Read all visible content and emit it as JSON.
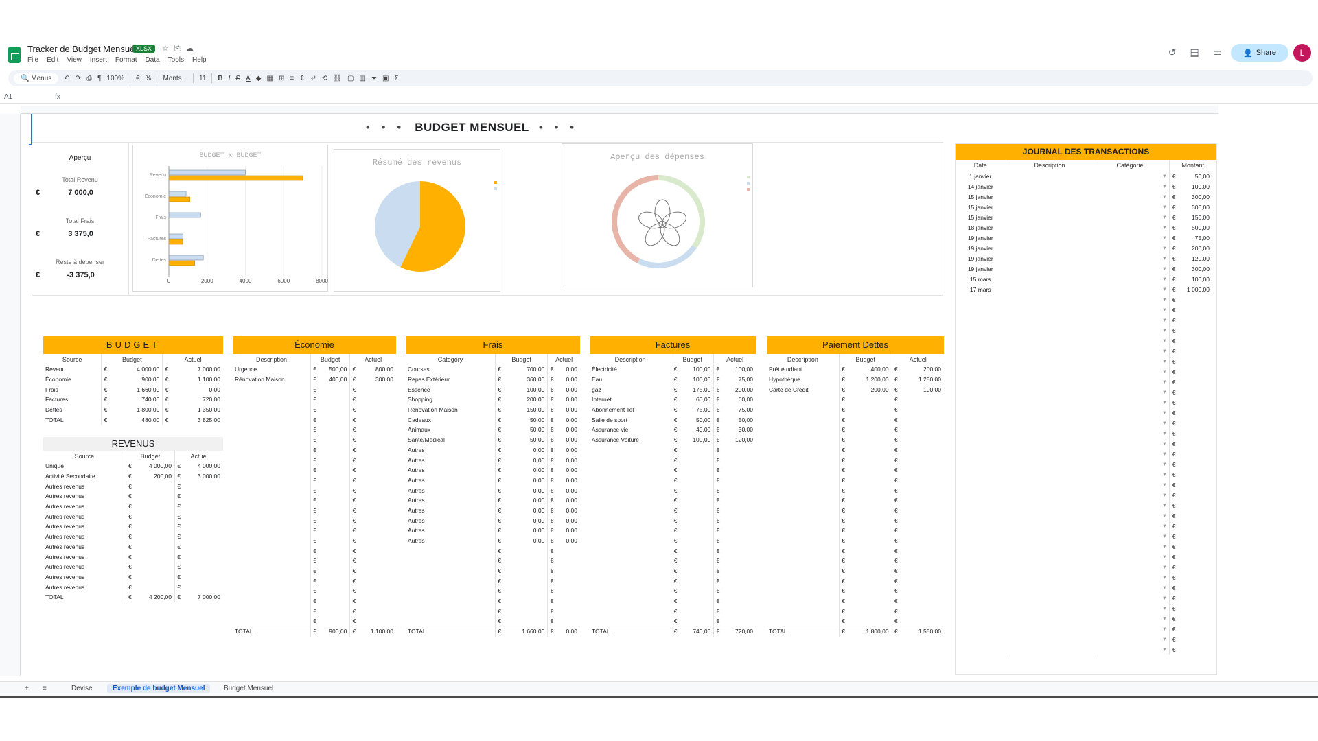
{
  "app": {
    "title": "Tracker de Budget Mensuel",
    "badge": "XLSX",
    "menu": [
      "File",
      "Edit",
      "View",
      "Insert",
      "Format",
      "Data",
      "Tools",
      "Help"
    ],
    "share_label": "Share",
    "avatar_letter": "L",
    "colors": {
      "accent": "#ffb000",
      "blue": "#c9dcf0",
      "sheets_green": "#0f9d58"
    }
  },
  "toolbar": {
    "menus_label": "Menus",
    "zoom": "100%",
    "font": "Monts...",
    "font_size": "11"
  },
  "formula": {
    "cell_ref": "A1",
    "fx": "fx"
  },
  "sheet": {
    "title": "BUDGET MENSUEL",
    "dots": "• • •"
  },
  "overview": {
    "heading": "Aperçu",
    "kpis": [
      {
        "label": "Total Revenu",
        "currency": "€",
        "value": "7 000,0"
      },
      {
        "label": "Total Frais",
        "currency": "€",
        "value": "3 375,0"
      },
      {
        "label": "Reste à dépenser",
        "currency": "€",
        "value": "-3 375,0"
      }
    ]
  },
  "chart_data": [
    {
      "type": "bar",
      "title": "BUDGET x BUDGET",
      "categories": [
        "Revenu",
        "Économie",
        "Frais",
        "Factures",
        "Dettes"
      ],
      "series": [
        {
          "values": [
            4000,
            900,
            1660,
            740,
            1800
          ]
        },
        {
          "values": [
            7000,
            1100,
            0,
            720,
            1350
          ]
        }
      ],
      "xlim": [
        0,
        8000
      ],
      "xticks": [
        0,
        2000,
        4000,
        6000,
        8000
      ],
      "colors": [
        "#c9dcf0",
        "#ffb000"
      ]
    },
    {
      "type": "pie",
      "title": "Résumé des revenus",
      "slices": [
        {
          "label": "Unique",
          "value": 4000,
          "color": "#ffb000"
        },
        {
          "label": "Activité Secondaire",
          "value": 3000,
          "color": "#c9dcf0"
        }
      ]
    },
    {
      "type": "pie",
      "title": "Aperçu des dépenses",
      "slices": [
        {
          "value": 1100,
          "color": "#d8e9cc"
        },
        {
          "value": 720,
          "color": "#c9dcf0"
        },
        {
          "value": 1350,
          "color": "#e8b4a8"
        }
      ]
    }
  ],
  "panels": {
    "budget": {
      "title": "BUDGET",
      "headers": [
        "Source",
        "Budget",
        "Actuel"
      ],
      "rows": [
        [
          "Revenu",
          "€",
          "4 000,00",
          "€",
          "7 000,00"
        ],
        [
          "Économie",
          "€",
          "900,00",
          "€",
          "1 100,00"
        ],
        [
          "Frais",
          "€",
          "1 660,00",
          "€",
          "0,00"
        ],
        [
          "Factures",
          "€",
          "740,00",
          "€",
          "720,00"
        ],
        [
          "Dettes",
          "€",
          "1 800,00",
          "€",
          "1 350,00"
        ],
        [
          "TOTAL",
          "€",
          "480,00",
          "€",
          "3 825,00"
        ]
      ]
    },
    "revenus": {
      "title": "REVENUS",
      "headers": [
        "Source",
        "Budget",
        "Actuel"
      ],
      "rows": [
        [
          "Unique",
          "€",
          "4 000,00",
          "€",
          "4 000,00"
        ],
        [
          "Activité Secondaire",
          "€",
          "200,00",
          "€",
          "3 000,00"
        ],
        [
          "Autres revenus",
          "€",
          "",
          "€",
          ""
        ],
        [
          "Autres revenus",
          "€",
          "",
          "€",
          ""
        ],
        [
          "Autres revenus",
          "€",
          "",
          "€",
          ""
        ],
        [
          "Autres revenus",
          "€",
          "",
          "€",
          ""
        ],
        [
          "Autres revenus",
          "€",
          "",
          "€",
          ""
        ],
        [
          "Autres revenus",
          "€",
          "",
          "€",
          ""
        ],
        [
          "Autres revenus",
          "€",
          "",
          "€",
          ""
        ],
        [
          "Autres revenus",
          "€",
          "",
          "€",
          ""
        ],
        [
          "Autres revenus",
          "€",
          "",
          "€",
          ""
        ],
        [
          "Autres revenus",
          "€",
          "",
          "€",
          ""
        ],
        [
          "Autres revenus",
          "€",
          "",
          "€",
          ""
        ],
        [
          "TOTAL",
          "€",
          "4 200,00",
          "€",
          "7 000,00"
        ]
      ]
    },
    "economie": {
      "title": "Économie",
      "headers": [
        "Description",
        "Budget",
        "Actuel"
      ],
      "rows": [
        [
          "Urgence",
          "€",
          "500,00",
          "€",
          "800,00"
        ],
        [
          "Rénovation Maison",
          "€",
          "400,00",
          "€",
          "300,00"
        ]
      ],
      "total": [
        "TOTAL",
        "€",
        "900,00",
        "€",
        "1 100,00"
      ]
    },
    "frais": {
      "title": "Frais",
      "headers": [
        "Category",
        "Budget",
        "Actuel"
      ],
      "rows": [
        [
          "Courses",
          "€",
          "700,00",
          "€",
          "0,00"
        ],
        [
          "Repas Extérieur",
          "€",
          "360,00",
          "€",
          "0,00"
        ],
        [
          "Essence",
          "€",
          "100,00",
          "€",
          "0,00"
        ],
        [
          "Shopping",
          "€",
          "200,00",
          "€",
          "0,00"
        ],
        [
          "Rénovation Maison",
          "€",
          "150,00",
          "€",
          "0,00"
        ],
        [
          "Cadeaux",
          "€",
          "50,00",
          "€",
          "0,00"
        ],
        [
          "Animaux",
          "€",
          "50,00",
          "€",
          "0,00"
        ],
        [
          "Santé/Médical",
          "€",
          "50,00",
          "€",
          "0,00"
        ],
        [
          "Autres",
          "€",
          "0,00",
          "€",
          "0,00"
        ],
        [
          "Autres",
          "€",
          "0,00",
          "€",
          "0,00"
        ],
        [
          "Autres",
          "€",
          "0,00",
          "€",
          "0,00"
        ],
        [
          "Autres",
          "€",
          "0,00",
          "€",
          "0,00"
        ],
        [
          "Autres",
          "€",
          "0,00",
          "€",
          "0,00"
        ],
        [
          "Autres",
          "€",
          "0,00",
          "€",
          "0,00"
        ],
        [
          "Autres",
          "€",
          "0,00",
          "€",
          "0,00"
        ],
        [
          "Autres",
          "€",
          "0,00",
          "€",
          "0,00"
        ],
        [
          "Autres",
          "€",
          "0,00",
          "€",
          "0,00"
        ],
        [
          "Autres",
          "€",
          "0,00",
          "€",
          "0,00"
        ]
      ],
      "total": [
        "TOTAL",
        "€",
        "1 660,00",
        "€",
        "0,00"
      ]
    },
    "factures": {
      "title": "Factures",
      "headers": [
        "Description",
        "Budget",
        "Actuel"
      ],
      "rows": [
        [
          "Électricité",
          "€",
          "100,00",
          "€",
          "100,00"
        ],
        [
          "Eau",
          "€",
          "100,00",
          "€",
          "75,00"
        ],
        [
          "gaz",
          "€",
          "175,00",
          "€",
          "200,00"
        ],
        [
          "Internet",
          "€",
          "60,00",
          "€",
          "60,00"
        ],
        [
          "Abonnement Tel",
          "€",
          "75,00",
          "€",
          "75,00"
        ],
        [
          "Salle de sport",
          "€",
          "50,00",
          "€",
          "50,00"
        ],
        [
          "Assurance vie",
          "€",
          "40,00",
          "€",
          "30,00"
        ],
        [
          "Assurance Voiture",
          "€",
          "100,00",
          "€",
          "120,00"
        ]
      ],
      "total": [
        "TOTAL",
        "€",
        "740,00",
        "€",
        "720,00"
      ]
    },
    "dettes": {
      "title": "Paiement Dettes",
      "headers": [
        "Description",
        "Budget",
        "Actuel"
      ],
      "rows": [
        [
          "Prêt étudiant",
          "€",
          "400,00",
          "€",
          "200,00"
        ],
        [
          "Hypothèque",
          "€",
          "1 200,00",
          "€",
          "1 250,00"
        ],
        [
          "Carte de Crédit",
          "€",
          "200,00",
          "€",
          "100,00"
        ]
      ],
      "total": [
        "TOTAL",
        "€",
        "1 800,00",
        "€",
        "1 550,00"
      ]
    }
  },
  "journal": {
    "title": "JOURNAL DES TRANSACTIONS",
    "headers": [
      "Date",
      "Description",
      "Catégorie",
      "Montant"
    ],
    "rows": [
      [
        "1 janvier",
        "€",
        "50,00"
      ],
      [
        "14 janvier",
        "€",
        "100,00"
      ],
      [
        "15 janvier",
        "€",
        "300,00"
      ],
      [
        "15 janvier",
        "€",
        "300,00"
      ],
      [
        "15 janvier",
        "€",
        "150,00"
      ],
      [
        "18 janvier",
        "€",
        "500,00"
      ],
      [
        "19 janvier",
        "€",
        "75,00"
      ],
      [
        "19 janvier",
        "€",
        "200,00"
      ],
      [
        "19 janvier",
        "€",
        "120,00"
      ],
      [
        "19 janvier",
        "€",
        "300,00"
      ],
      [
        "15 mars",
        "€",
        "100,00"
      ],
      [
        "17 mars",
        "€",
        "1 000,00"
      ]
    ]
  },
  "tabs": [
    {
      "label": "Devise",
      "active": false
    },
    {
      "label": "Exemple de budget Mensuel",
      "active": true
    },
    {
      "label": "Budget Mensuel",
      "active": false
    }
  ]
}
